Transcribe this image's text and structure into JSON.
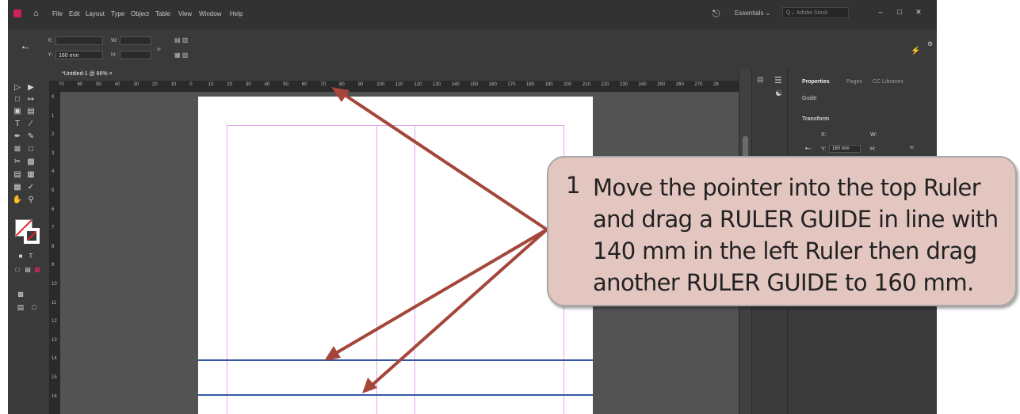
{
  "menubar": {
    "items": [
      "File",
      "Edit",
      "Layout",
      "Type",
      "Object",
      "Table",
      "View",
      "Window",
      "Help"
    ],
    "workspace": "Essentials ⌄",
    "stock_search_placeholder": "Q⌄ Adobe Stock",
    "window_buttons": [
      "–",
      "□",
      "✕"
    ]
  },
  "controlbar": {
    "x_label": "X:",
    "y_label": "Y:",
    "y_value": "160 mm",
    "w_label": "W:",
    "h_label": "H:"
  },
  "document_tab": {
    "title": "*Untitled-1 @ 86% ×"
  },
  "ruler_top_ticks": [
    "70",
    "60",
    "50",
    "40",
    "30",
    "20",
    "10",
    "0",
    "10",
    "20",
    "30",
    "40",
    "50",
    "60",
    "70",
    "80",
    "90",
    "100",
    "110",
    "120",
    "130",
    "140",
    "150",
    "160",
    "170",
    "180",
    "190",
    "200",
    "210",
    "220",
    "230",
    "240",
    "250",
    "260",
    "270",
    "28"
  ],
  "ruler_left_ticks": [
    "0",
    "1",
    "2",
    "3",
    "4",
    "5",
    "6",
    "7",
    "8",
    "9",
    "10",
    "11",
    "12",
    "13",
    "14",
    "15",
    "16"
  ],
  "properties_panel": {
    "tabs": [
      "Properties",
      "Pages",
      "CC Libraries"
    ],
    "section": "Guide",
    "group": "Transform",
    "x_label": "X:",
    "w_label": "W:",
    "y_label": "Y:",
    "y_value": "160 mm",
    "h_label": "H:"
  },
  "callout": {
    "number": "1",
    "text": "Move the pointer into the top Ruler and drag a RULER GUIDE in line with 140 mm in the left Ruler then drag another RULER GUIDE to 160 mm."
  },
  "colors": {
    "arrow": "#a5463b",
    "guide": "#3657a6",
    "margin": "#e5a6e9",
    "callout_fill": "#e3c6c0",
    "app_logo": "#d0215b"
  }
}
